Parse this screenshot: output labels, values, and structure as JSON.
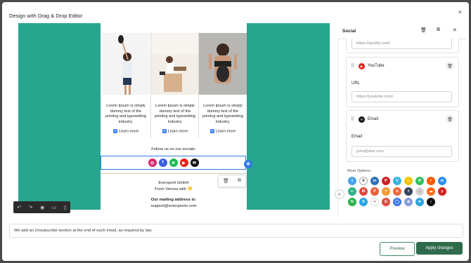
{
  "modal": {
    "title": "Design with Drag & Drop Editor",
    "close": "×"
  },
  "email": {
    "products": [
      {
        "text": "Lorem Ipsum is simply dummy text of the printing and typesetting industry.",
        "link": "Learn more"
      },
      {
        "text": "Lorem Ipsum is simply dummy text of the printing and typesetting industry.",
        "link": "Learn more"
      },
      {
        "text": "Lorem Ipsum is simply dummy text of the printing and typesetting industry.",
        "link": "Learn more"
      }
    ],
    "follow_text": "Follow us on our socials:",
    "social_icons": [
      {
        "name": "instagram-icon",
        "glyph": "◎",
        "color": "#d6296f"
      },
      {
        "name": "facebook-icon",
        "glyph": "f",
        "color": "#3b5ed9"
      },
      {
        "name": "spotify-icon",
        "glyph": "≋",
        "color": "#1db954"
      },
      {
        "name": "youtube-icon",
        "glyph": "▶",
        "color": "#e62117"
      },
      {
        "name": "email-icon",
        "glyph": "✉",
        "color": "#111111"
      }
    ],
    "company": "Eversport GmbH",
    "from": "From Vienna with 💛",
    "mailing_label": "Our mailing address is:",
    "mailing_email": "support@eversports.com"
  },
  "panel": {
    "title": "Social",
    "spotify_url_placeholder": "https://spotify.com/",
    "youtube": {
      "label": "YouTube",
      "url_label": "URL",
      "placeholder": "https://youtube.com/"
    },
    "email": {
      "label": "Email",
      "field_label": "Email",
      "placeholder": "john@doe.com"
    },
    "more_options_label": "More Options",
    "more_options_icons": [
      {
        "name": "twitter-icon",
        "glyph": "t",
        "color": "#4aa3e8"
      },
      {
        "name": "x-icon",
        "glyph": "X",
        "color": "#777777"
      },
      {
        "name": "linkedin-icon",
        "glyph": "in",
        "color": "#2f6db0"
      },
      {
        "name": "pinterest-icon",
        "glyph": "P",
        "color": "#cb2027"
      },
      {
        "name": "vimeo-icon",
        "glyph": "V",
        "color": "#36b3e3"
      },
      {
        "name": "snapchat-icon",
        "glyph": "☺",
        "color": "#f4c400"
      },
      {
        "name": "whatsapp-icon",
        "glyph": "✆",
        "color": "#2fbf5b"
      },
      {
        "name": "reddit-icon",
        "glyph": "r",
        "color": "#ff5700"
      },
      {
        "name": "messenger-icon",
        "glyph": "m",
        "color": "#2b8ef0"
      },
      {
        "name": "tripadvisor-icon",
        "glyph": "∞",
        "color": "#34b08a"
      },
      {
        "name": "medium-icon",
        "glyph": "M",
        "color": "#e04a3f"
      },
      {
        "name": "producthunt-icon",
        "glyph": "P",
        "color": "#e8603c"
      },
      {
        "name": "rss-icon",
        "glyph": "≈",
        "color": "#f39c34"
      },
      {
        "name": "tinder-icon",
        "glyph": "♨",
        "color": "#f2663b"
      },
      {
        "name": "tumblr-icon",
        "glyph": "t",
        "color": "#36465d"
      },
      {
        "name": "music-icon",
        "glyph": "♪",
        "color": "#d0d0d0"
      },
      {
        "name": "soundcloud-icon",
        "glyph": "☁",
        "color": "#ff6a1a"
      },
      {
        "name": "yelp-icon",
        "glyph": "y",
        "color": "#d32323"
      },
      {
        "name": "meetup-icon",
        "glyph": "N",
        "color": "#2bb24c"
      },
      {
        "name": "skype-icon",
        "glyph": "S",
        "color": "#2aa5e0"
      },
      {
        "name": "flickr-icon",
        "glyph": "••",
        "color": "#ffffff"
      },
      {
        "name": "google-plus-icon",
        "glyph": "G",
        "color": "#dc4e41"
      },
      {
        "name": "signal-icon",
        "glyph": "◯",
        "color": "#3a76f0"
      },
      {
        "name": "discord-icon",
        "glyph": "☻",
        "color": "#8a9bd8"
      },
      {
        "name": "telegram-icon",
        "glyph": "➤",
        "color": "#2ca5e0"
      },
      {
        "name": "tiktok-icon",
        "glyph": "♪",
        "color": "#111111"
      }
    ]
  },
  "notice": "We add an Unsubscribe section at the end of each email, as required by law.",
  "buttons": {
    "preview": "Preview",
    "apply": "Apply changes"
  },
  "colors": {
    "canvas_bg": "#27a58e",
    "selection": "#2f7be5",
    "primary": "#2f6a4d"
  }
}
